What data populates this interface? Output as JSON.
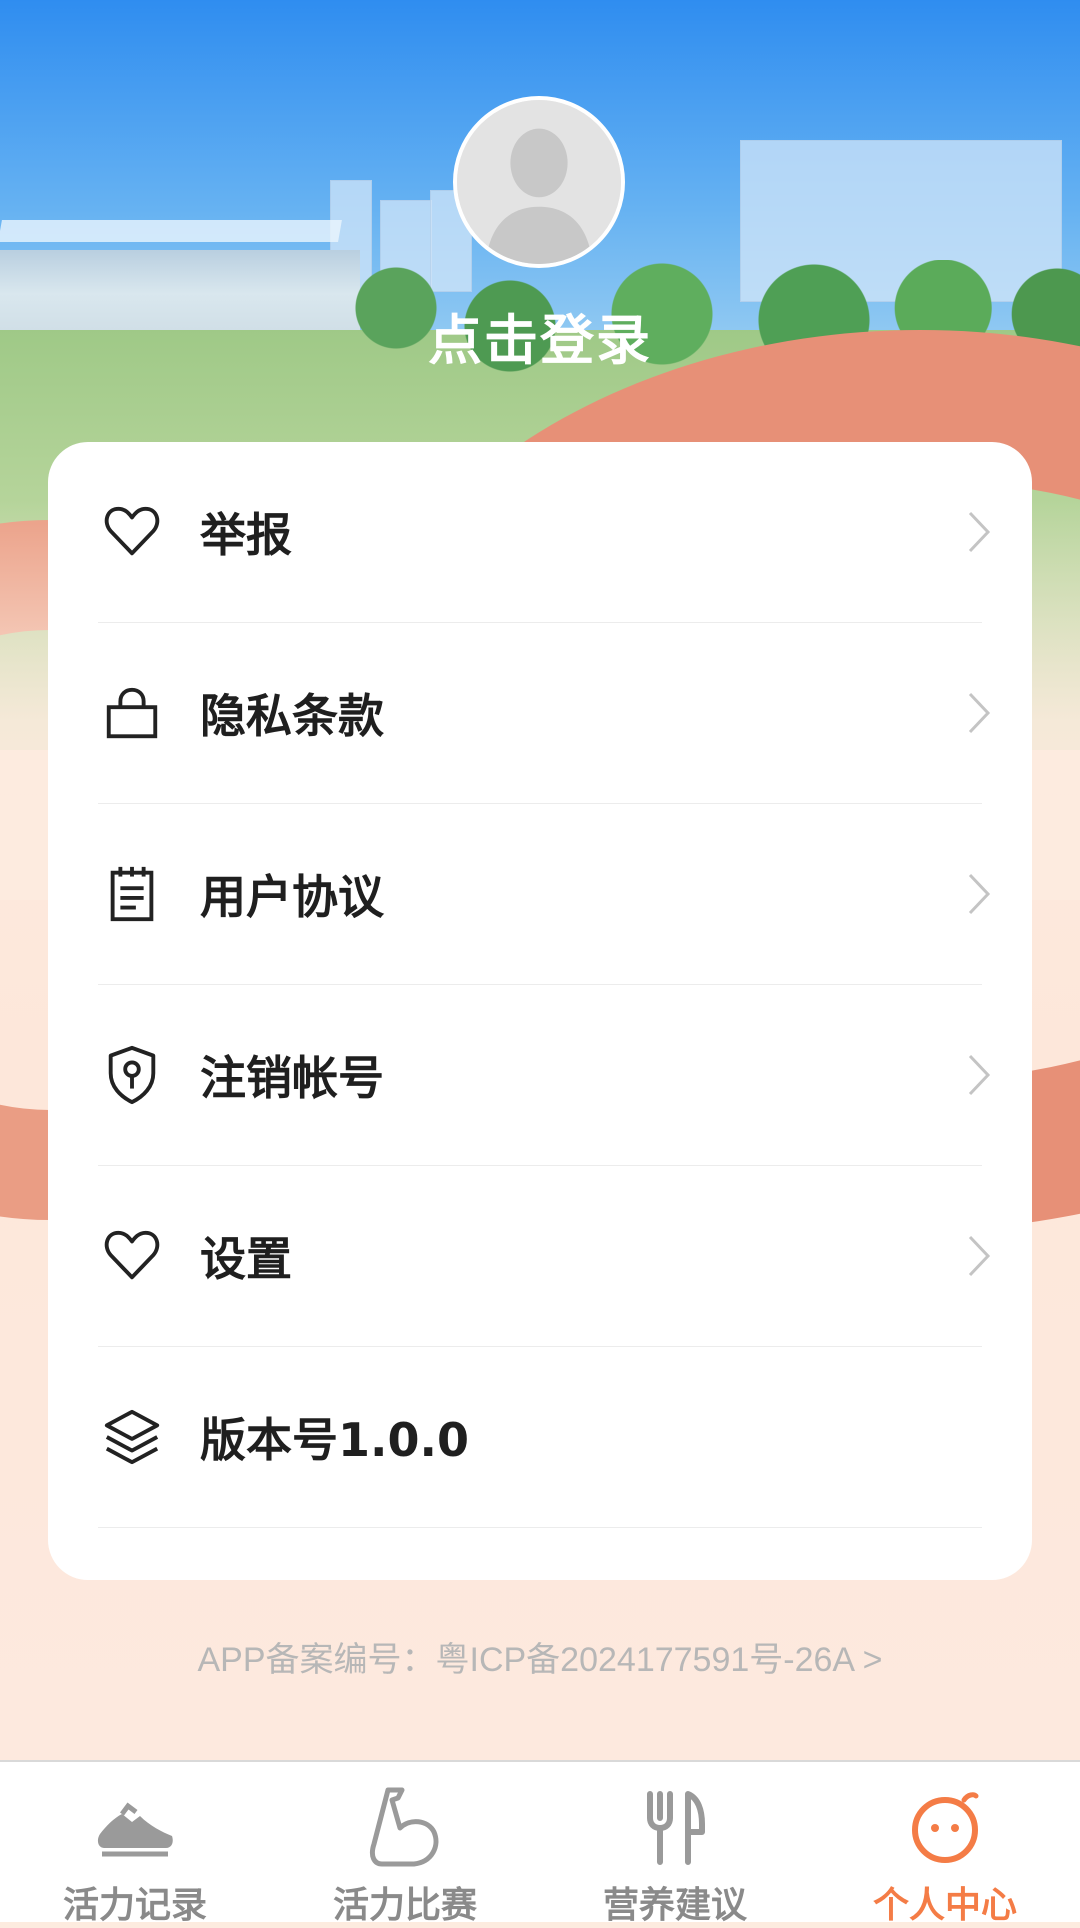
{
  "profile": {
    "login_text": "点击登录"
  },
  "menu": {
    "items": [
      {
        "label": "举报",
        "icon": "heart-icon"
      },
      {
        "label": "隐私条款",
        "icon": "lock-icon"
      },
      {
        "label": "用户协议",
        "icon": "clipboard-icon"
      },
      {
        "label": "注销帐号",
        "icon": "shield-key-icon"
      },
      {
        "label": "设置",
        "icon": "heart-icon"
      },
      {
        "label": "版本号1.0.0",
        "icon": "layers-icon"
      }
    ]
  },
  "footer": {
    "icp": "APP备案编号：粤ICP备2024177591号-26A >"
  },
  "tabbar": {
    "tabs": [
      {
        "label": "活力记录",
        "icon": "sneaker-icon"
      },
      {
        "label": "活力比赛",
        "icon": "muscle-arm-icon"
      },
      {
        "label": "营养建议",
        "icon": "fork-knife-icon"
      },
      {
        "label": "个人中心",
        "icon": "smiley-face-icon",
        "active": true
      }
    ]
  },
  "colors": {
    "accent": "#f47c46",
    "inactive": "#8a8a8a"
  }
}
